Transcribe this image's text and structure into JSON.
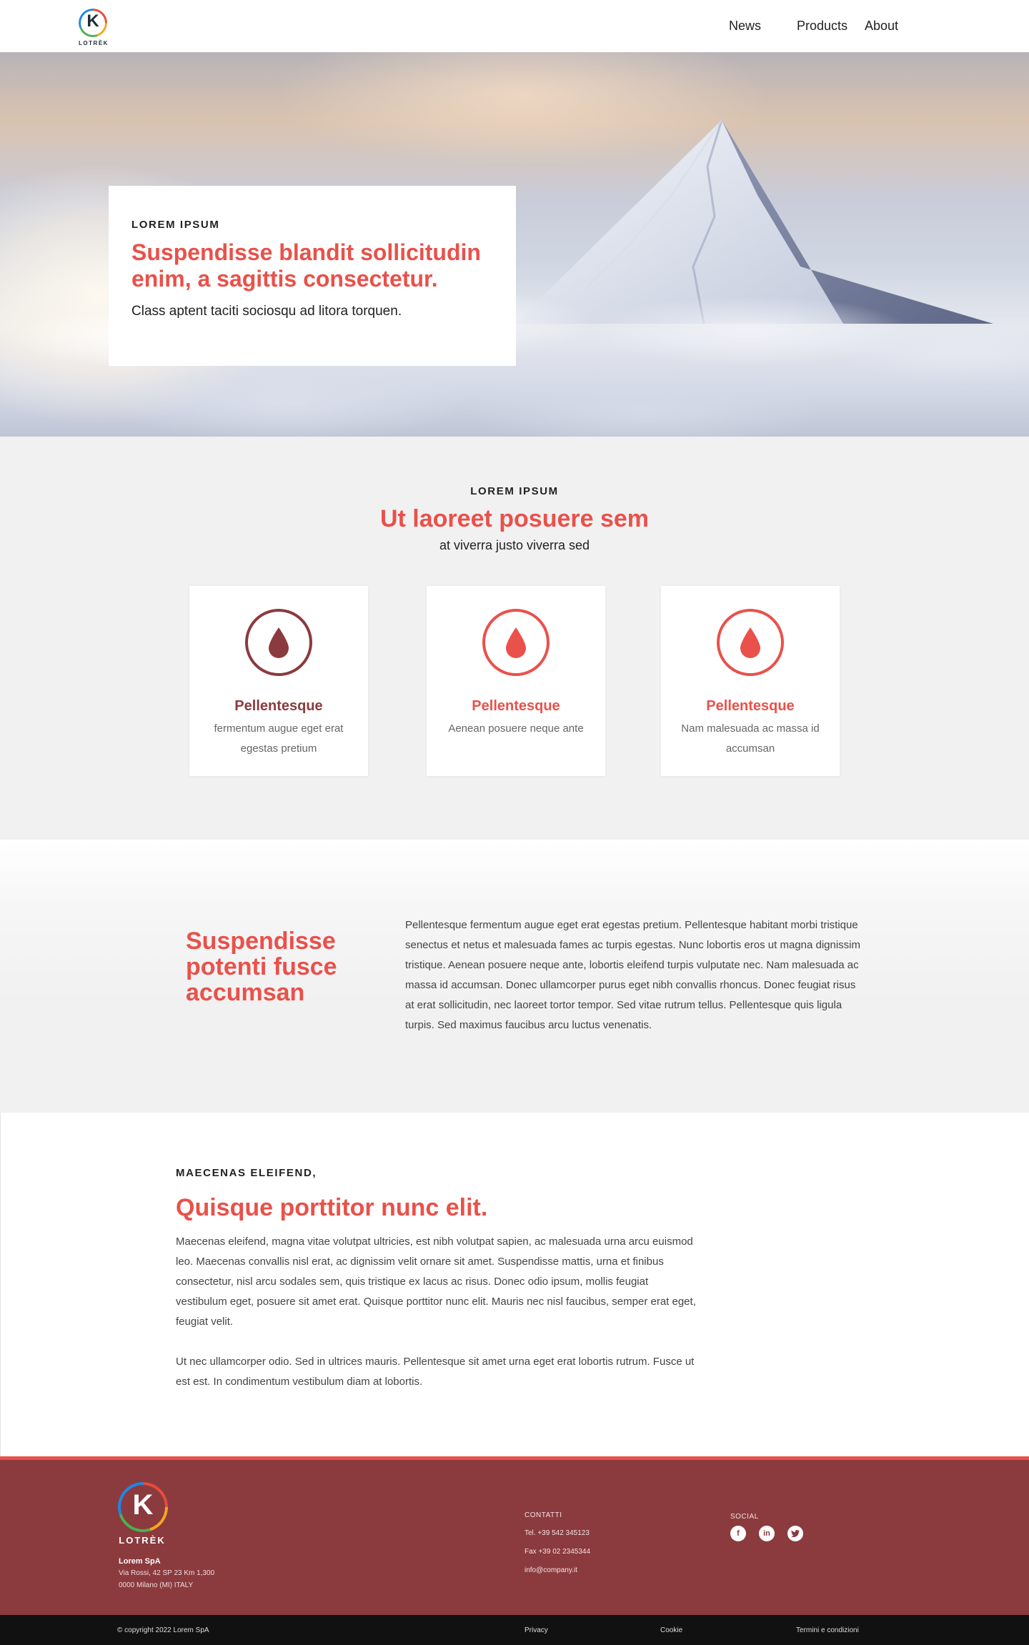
{
  "header": {
    "logo_text": "LOTRÈK",
    "logo_letter": "K",
    "nav": [
      "News",
      "Products",
      "About"
    ]
  },
  "hero": {
    "eyebrow": "LOREM IPSUM",
    "title": "Suspendisse blandit sollicitudin enim, a sagittis consectetur.",
    "subtitle": "Class aptent taciti sociosqu ad litora torquen."
  },
  "features": {
    "eyebrow": "LOREM IPSUM",
    "title": "Ut laoreet posuere sem",
    "subtitle": "at viverra justo viverra sed",
    "cards": [
      {
        "icon": "drop-icon",
        "title": "Pellentesque",
        "text": "fermentum augue eget erat egestas pretium"
      },
      {
        "icon": "drop-icon",
        "title": "Pellentesque",
        "text": "Aenean posuere neque ante"
      },
      {
        "icon": "drop-icon",
        "title": "Pellentesque",
        "text": "Nam malesuada ac massa id accumsan"
      }
    ]
  },
  "textblock": {
    "title": "Suspendisse potenti fusce accumsan",
    "text": "Pellentesque fermentum augue eget erat egestas pretium. Pellentesque habitant morbi tristique senectus et netus et malesuada fames ac turpis egestas. Nunc lobortis eros ut magna dignissim tristique. Aenean posuere neque ante, lobortis eleifend turpis vulputate nec. Nam malesuada ac massa id accumsan. Donec ullamcorper purus eget nibh convallis rhoncus. Donec feugiat risus at erat sollicitudin, nec laoreet tortor tempor. Sed vitae rutrum tellus. Pellentesque quis ligula turpis. Sed maximus faucibus arcu luctus venenatis."
  },
  "article": {
    "eyebrow": "MAECENAS ELEIFEND,",
    "title": "Quisque porttitor nunc elit.",
    "paragraphs": [
      "Maecenas eleifend, magna vitae volutpat ultricies, est nibh volutpat sapien, ac malesuada urna arcu euismod leo. Maecenas convallis nisl erat, ac dignissim velit ornare sit amet. Suspendisse mattis, urna et finibus consectetur, nisl arcu sodales sem, quis tristique ex lacus ac risus. Donec odio ipsum, mollis feugiat vestibulum eget, posuere sit amet erat. Quisque porttitor nunc elit. Mauris nec nisl faucibus, semper erat eget, feugiat velit.",
      "Ut nec ullamcorper odio. Sed in ultrices mauris. Pellentesque sit amet urna eget erat lobortis rutrum. Fusce ut est est. In condimentum vestibulum diam at lobortis."
    ]
  },
  "footer": {
    "logo_text": "LOTRÈK",
    "logo_letter": "K",
    "company": "Lorem SpA",
    "address": [
      "Via Rossi, 42 SP 23 Km 1,300",
      "0000 Milano (MI) ITALY"
    ],
    "contacts_heading": "CONTATTI",
    "contacts": [
      "Tel. +39 542 345123",
      "Fax +39 02 2345344",
      "info@company.it"
    ],
    "social_heading": "SOCIAL",
    "social": [
      "facebook-icon",
      "linkedin-icon",
      "twitter-icon"
    ],
    "copyright": "© copyright 2022 Lorem SpA",
    "links": [
      "Privacy",
      "Cookie",
      "Termini e condizioni"
    ]
  },
  "colors": {
    "accent": "#e9514a",
    "footer_bg": "#8b3a3e",
    "card_dark": "#8b3a3e",
    "section_bg": "#f1f1f2",
    "bottom_bar": "#111111"
  }
}
